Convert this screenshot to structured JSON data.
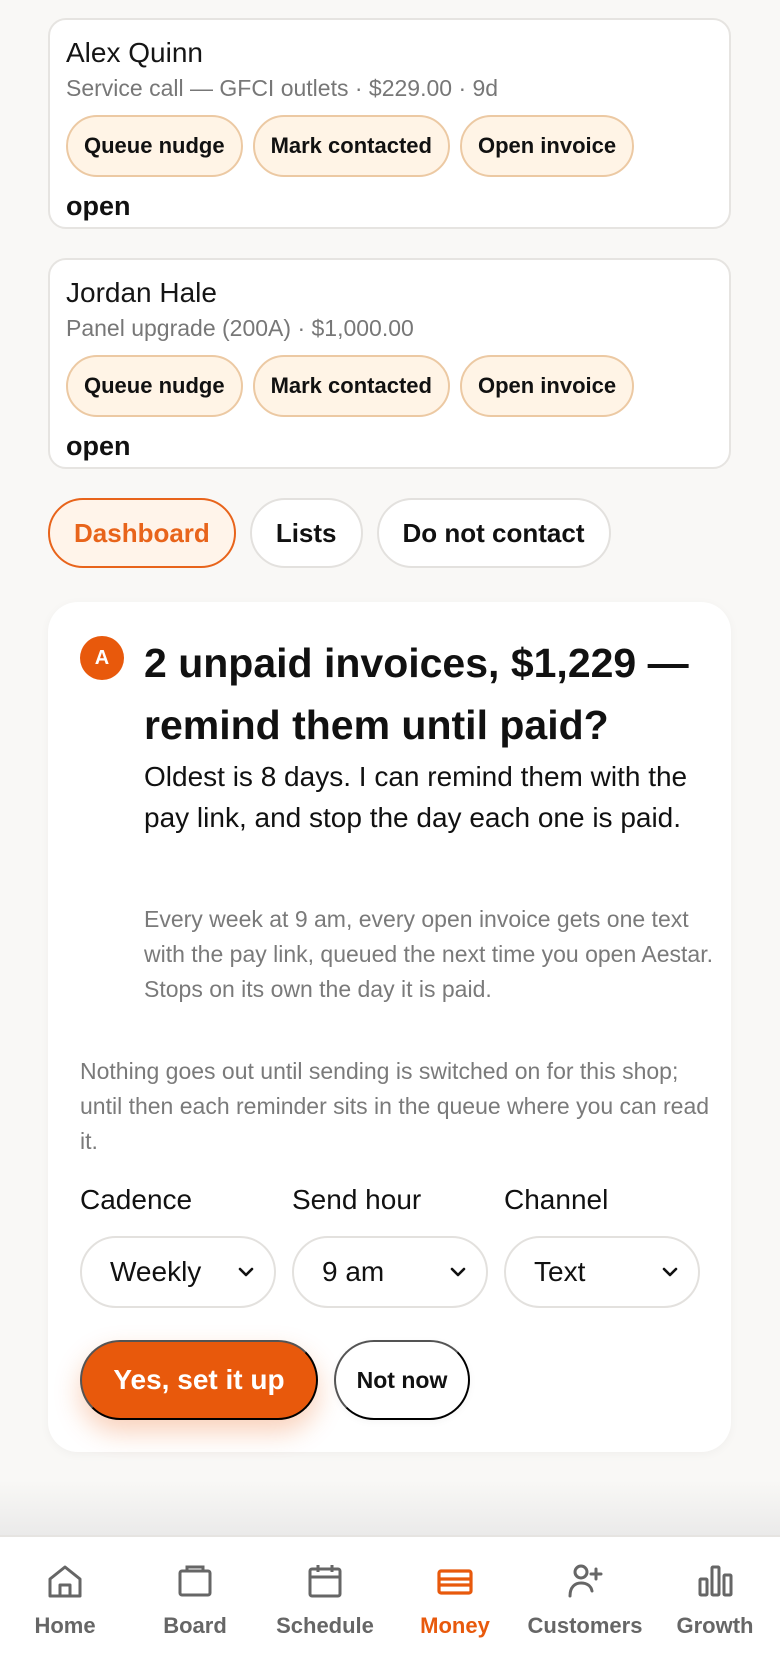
{
  "invoices": [
    {
      "name": "Alex Quinn",
      "detail": "Service call — GFCI outlets · $229.00 · 9d",
      "actions": [
        "Queue nudge",
        "Mark contacted",
        "Open invoice"
      ],
      "status": "open"
    },
    {
      "name": "Jordan Hale",
      "detail": "Panel upgrade (200A) · $1,000.00",
      "actions": [
        "Queue nudge",
        "Mark contacted",
        "Open invoice"
      ],
      "status": "open"
    }
  ],
  "tabs": [
    {
      "label": "Dashboard",
      "active": true
    },
    {
      "label": "Lists",
      "active": false
    },
    {
      "label": "Do not contact",
      "active": false
    }
  ],
  "assistant": {
    "avatar": "A",
    "headline": "2 unpaid invoices, $1,229 — remind them until paid?",
    "lead": "Oldest is 8 days. I can remind them with the pay link, and stop the day each one is paid.",
    "detail": "Every week at 9 am, every open invoice gets one text with the pay link, queued the next time you open Aestar. Stops on its own the day it is paid.",
    "note": "Nothing goes out until sending is switched on for this shop; until then each reminder sits in the queue where you can read it.",
    "fields": {
      "cadence": {
        "label": "Cadence",
        "value": "Weekly"
      },
      "send_hour": {
        "label": "Send hour",
        "value": "9 am"
      },
      "channel": {
        "label": "Channel",
        "value": "Text"
      }
    },
    "primary_label": "Yes, set it up",
    "secondary_label": "Not now"
  },
  "nav": [
    {
      "label": "Home",
      "icon": "home-icon",
      "active": false
    },
    {
      "label": "Board",
      "icon": "board-icon",
      "active": false
    },
    {
      "label": "Schedule",
      "icon": "calendar-icon",
      "active": false
    },
    {
      "label": "Money",
      "icon": "card-icon",
      "active": true
    },
    {
      "label": "Customers",
      "icon": "add-person-icon",
      "active": false
    },
    {
      "label": "Growth",
      "icon": "bar-chart-icon",
      "active": false
    }
  ],
  "colors": {
    "accent": "#e8590c",
    "chip_bg": "#fff4e6",
    "chip_border": "#ecc9a3",
    "muted_text": "#7a7a7a"
  }
}
